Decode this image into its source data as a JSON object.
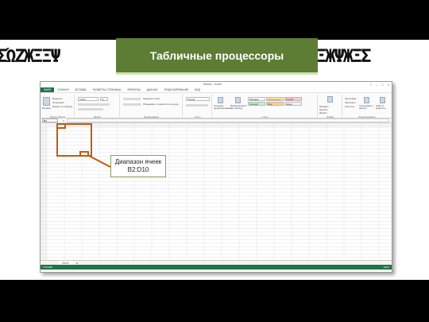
{
  "slide": {
    "title": "Табличные процессоры",
    "deco_left": "ΣΏΖЖΞΞΨ",
    "deco_right": "ΞЖΨЖΞΣ"
  },
  "excel": {
    "window_title": "Книга1 - Excel",
    "window_controls": [
      "?",
      "–",
      "□",
      "×"
    ],
    "tabs": [
      "ФАЙЛ",
      "ГЛАВНАЯ",
      "ВСТАВКА",
      "РАЗМЕТКА СТРАНИЦЫ",
      "ФОРМУЛЫ",
      "ДАННЫЕ",
      "РЕЦЕНЗИРОВАНИЕ",
      "ВИД"
    ],
    "ribbon": {
      "paste_label": "Вставить",
      "clipboard_items": [
        "Вырезать",
        "Копировать",
        "Формат по образцу"
      ],
      "font_name": "Calibri",
      "font_size": "11",
      "wrap_label": "Перенести текст",
      "merge_label": "Объединить и поместить в центре",
      "number_format": "Общий",
      "cond_format_label": "Условное форматирование",
      "format_table_label": "Форматировать как таблицу",
      "styles": [
        {
          "label": "Обычный",
          "bg": "#ffffff",
          "fg": "#000000"
        },
        {
          "label": "Нейтральный",
          "bg": "#ffeb9c",
          "fg": "#9c6500"
        },
        {
          "label": "Плохой",
          "bg": "#ffc7ce",
          "fg": "#9c0006"
        },
        {
          "label": "Хороший",
          "bg": "#c6efce",
          "fg": "#006100"
        },
        {
          "label": "Ввод",
          "bg": "#ffcc99",
          "fg": "#3f3f76"
        },
        {
          "label": "Вывод",
          "bg": "#f2f2f2",
          "fg": "#3f3f3f"
        }
      ],
      "cells_buttons": [
        "Вставить",
        "Удалить",
        "Формат"
      ],
      "editing_items": [
        "Автосумма",
        "Заполнить",
        "Очистить"
      ],
      "sort_label": "Сортировка и фильтр",
      "find_label": "Найти и выделить",
      "group_names": [
        "Буфер обмена",
        "Шрифт",
        "Выравнивание",
        "Число",
        "Стили",
        "Ячейки",
        "Редактирование"
      ]
    },
    "name_box": "B2",
    "fx_label": "fx",
    "sheet_tab": "Лист1",
    "add_sheet": "⊕",
    "status": "ГОТОВО",
    "zoom": "100%"
  },
  "callout": {
    "line1": "Диапазон ячеек",
    "line2": "B2:D10"
  },
  "colors": {
    "accent_green": "#5c7d33",
    "excel_green": "#217346",
    "range_outline": "#c55a11",
    "callout_border": "#8aa35e"
  }
}
